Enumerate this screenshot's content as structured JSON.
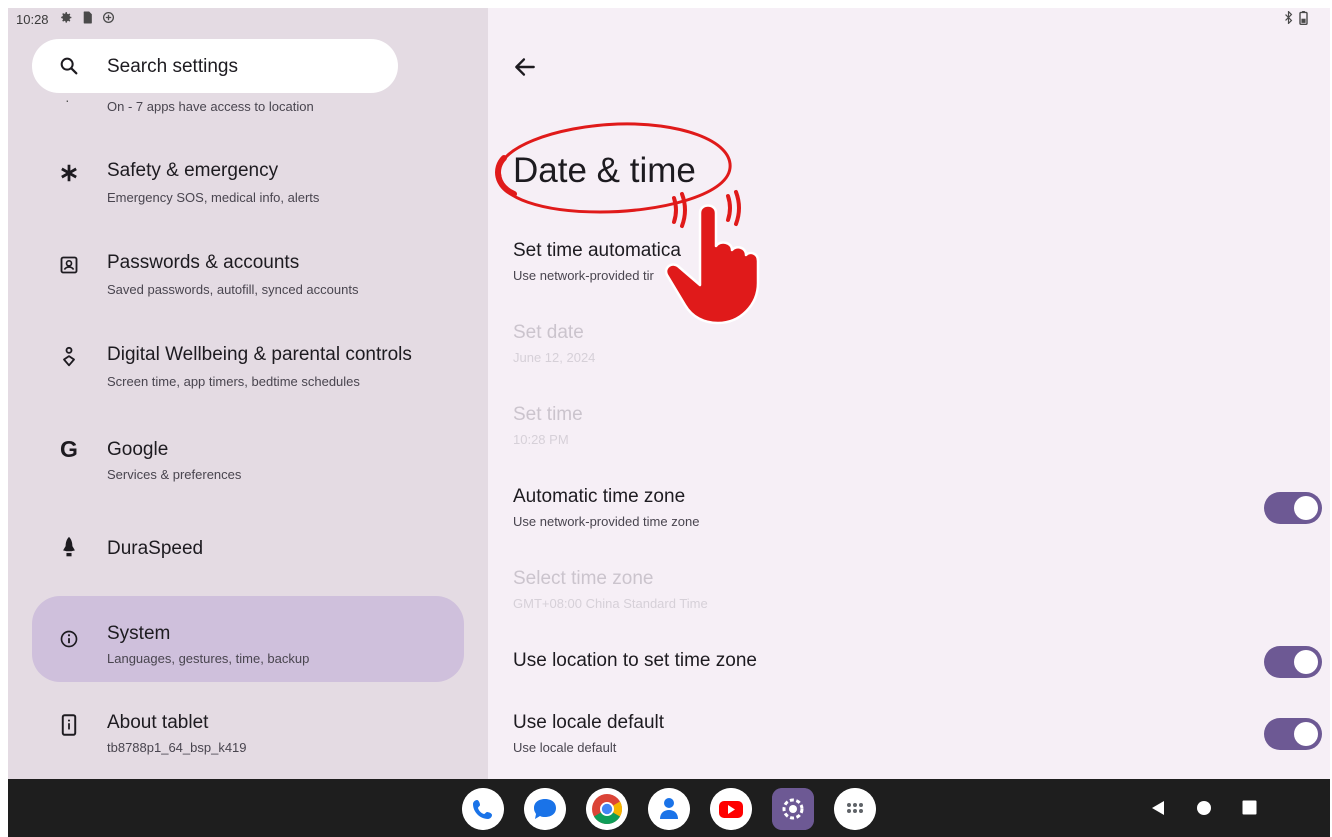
{
  "status_bar": {
    "time": "10:28",
    "left_icons": [
      "gear-icon",
      "sim-card-icon",
      "data-saver-icon"
    ],
    "right_icons": [
      "bluetooth-icon",
      "battery-icon"
    ]
  },
  "search": {
    "placeholder": "Search settings"
  },
  "sidebar": {
    "location_summary": "On - 7 apps have access to location",
    "items": [
      {
        "title": "Safety & emergency",
        "subtitle": "Emergency SOS, medical info, alerts",
        "icon": "asterisk-icon"
      },
      {
        "title": "Passwords & accounts",
        "subtitle": "Saved passwords, autofill, synced accounts",
        "icon": "account-box-icon"
      },
      {
        "title": "Digital Wellbeing & parental controls",
        "subtitle": "Screen time, app timers, bedtime schedules",
        "icon": "wellbeing-icon"
      },
      {
        "title": "Google",
        "subtitle": "Services & preferences",
        "icon": "google-icon",
        "glyph": "G"
      },
      {
        "title": "DuraSpeed",
        "subtitle": "",
        "icon": "rocket-icon"
      },
      {
        "title": "System",
        "subtitle": "Languages, gestures, time, backup",
        "icon": "info-icon",
        "selected": true
      },
      {
        "title": "About tablet",
        "subtitle": "tb8788p1_64_bsp_k419",
        "icon": "tablet-icon"
      }
    ]
  },
  "detail": {
    "title": "Date & time",
    "settings": [
      {
        "title": "Set time automatica",
        "subtitle": "Use network-provided tir",
        "enabled": true,
        "toggle": null
      },
      {
        "title": "Set date",
        "subtitle": "June 12, 2024",
        "enabled": false,
        "toggle": null
      },
      {
        "title": "Set time",
        "subtitle": "10:28 PM",
        "enabled": false,
        "toggle": null
      },
      {
        "title": "Automatic time zone",
        "subtitle": "Use network-provided time zone",
        "enabled": true,
        "toggle": true
      },
      {
        "title": "Select time zone",
        "subtitle": "GMT+08:00 China Standard Time",
        "enabled": false,
        "toggle": null
      },
      {
        "title": "Use location to set time zone",
        "subtitle": "",
        "enabled": true,
        "toggle": true
      },
      {
        "title": "Use locale default",
        "subtitle": "Use locale default",
        "enabled": true,
        "toggle": true
      }
    ]
  },
  "dock": {
    "apps": [
      "phone-icon",
      "messages-icon",
      "chrome-icon",
      "contacts-icon",
      "youtube-icon",
      "settings-icon",
      "app-drawer-icon"
    ]
  },
  "nav": {
    "buttons": [
      "back-icon",
      "home-icon",
      "recents-icon"
    ]
  },
  "colors": {
    "left_pane_bg": "#e4dbe3",
    "right_pane_bg": "#f6eff6",
    "selected_item_bg": "#cfc0dc",
    "toggle_on": "#6d5994",
    "annotation_red": "#e01a1a",
    "nav_bar_bg": "#1e1e1e"
  }
}
